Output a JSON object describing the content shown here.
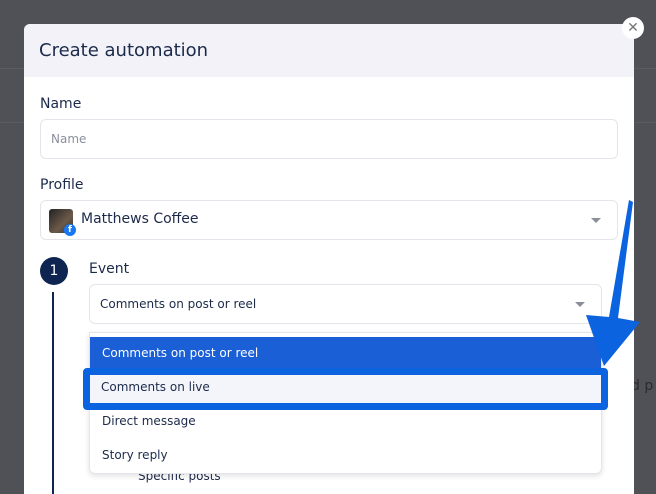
{
  "background": {
    "partial_text": "d p"
  },
  "modal": {
    "title": "Create automation",
    "name": {
      "label": "Name",
      "placeholder": "Name",
      "value": ""
    },
    "profile": {
      "label": "Profile",
      "value": "Matthews Coffee",
      "network_icon": "facebook-icon"
    },
    "event": {
      "step": "1",
      "label": "Event",
      "value": "Comments on post or reel",
      "options": [
        "Comments on post or reel",
        "Comments on live",
        "Direct message",
        "Story reply"
      ],
      "selected_index": 0,
      "highlighted_index": 1
    },
    "partial_below": "Specific posts"
  },
  "colors": {
    "accent": "#1a5fd6",
    "highlight": "#0b63e0",
    "navy": "#0d2550"
  }
}
